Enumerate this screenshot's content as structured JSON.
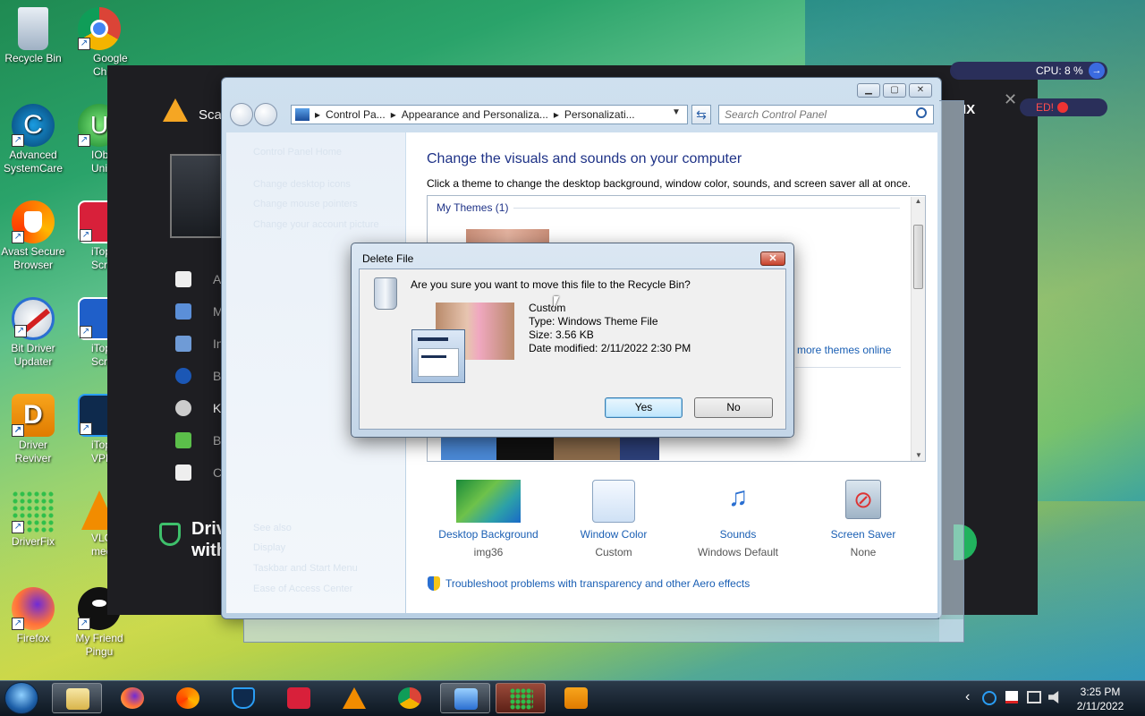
{
  "desktop": {
    "icons": [
      {
        "label": "Recycle Bin"
      },
      {
        "label": "Google Chrome"
      },
      {
        "label": "Advanced SystemCare"
      },
      {
        "label": "IObit Uninstaller"
      },
      {
        "label": "Avast Secure Browser"
      },
      {
        "label": "iTop Screen Recorder"
      },
      {
        "label": "Bit Driver Updater"
      },
      {
        "label": "iTop Screenshot"
      },
      {
        "label": "Driver Reviver"
      },
      {
        "label": "iTop VPN"
      },
      {
        "label": "DriverFix"
      },
      {
        "label": "VLC media player"
      },
      {
        "label": "Firefox"
      },
      {
        "label": "My Friend Pingu"
      }
    ]
  },
  "background_app": {
    "scan_label": "Sca",
    "driver_text": "Driv",
    "with_text": "with",
    "cpu_label": "CPU: 8 %",
    "ed_label": "ED!",
    "ix_label": "IX",
    "menu_letters": [
      "A",
      "M",
      "In",
      "B",
      "K",
      "B",
      "C"
    ]
  },
  "control_panel": {
    "address": {
      "crumbs": [
        "Control Pa...",
        "Appearance and Personaliza...",
        "Personalizati..."
      ]
    },
    "search_placeholder": "Search Control Panel",
    "left_links": [
      "Control Panel Home",
      "Change desktop icons",
      "Change mouse pointers",
      "Change your account picture"
    ],
    "left_see_also": [
      "See also",
      "Display",
      "Taskbar and Start Menu",
      "Ease of Access Center"
    ],
    "title": "Change the visuals and sounds on your computer",
    "subtitle": "Click a theme to change the desktop background, window color, sounds, and screen saver all at once.",
    "my_themes": "My Themes (1)",
    "more_themes": "more themes online",
    "bottom_items": [
      {
        "label": "Desktop Background",
        "value": "img36"
      },
      {
        "label": "Window Color",
        "value": "Custom"
      },
      {
        "label": "Sounds",
        "value": "Windows Default"
      },
      {
        "label": "Screen Saver",
        "value": "None"
      }
    ],
    "troubleshoot_link": "Troubleshoot problems with transparency and other Aero effects"
  },
  "dialog": {
    "title": "Delete File",
    "close_glyph": "✕",
    "question": "Are you sure you want to move this file to the Recycle Bin?",
    "file_name": "Custom",
    "file_type": "Type: Windows Theme File",
    "file_size": "Size: 3.56 KB",
    "date_modified": "Date modified: 2/11/2022 2:30 PM",
    "yes_label": "Yes",
    "no_label": "No"
  },
  "taskbar": {
    "time": "3:25 PM",
    "date": "2/11/2022",
    "tray_chevron": "‹"
  },
  "colors": {
    "link": "#1a5fb4",
    "title": "#1e3287",
    "taskbar": "#1a2533"
  }
}
